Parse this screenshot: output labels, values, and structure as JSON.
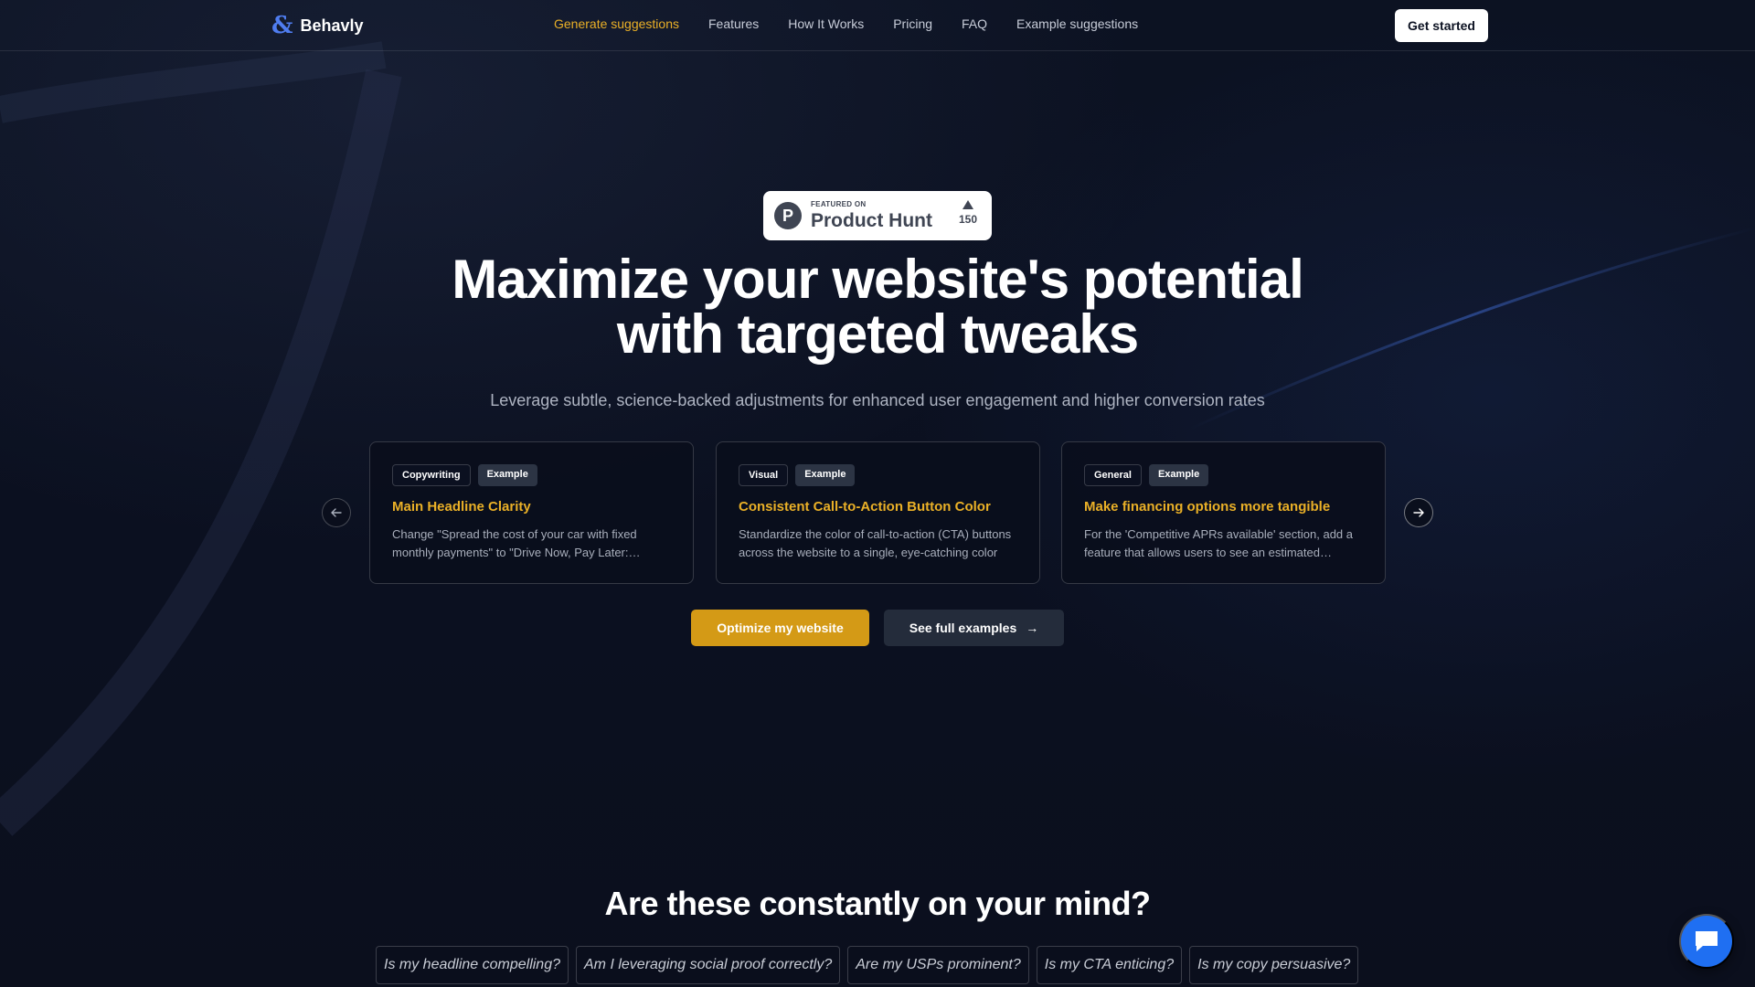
{
  "brand": {
    "name": "Behavly",
    "icon": "ampersand-logo-icon",
    "accent": "#4f7df0"
  },
  "nav": {
    "links": [
      {
        "label": "Generate suggestions",
        "active": true
      },
      {
        "label": "Features"
      },
      {
        "label": "How It Works"
      },
      {
        "label": "Pricing"
      },
      {
        "label": "FAQ"
      },
      {
        "label": "Example suggestions"
      }
    ],
    "cta": "Get started"
  },
  "badge": {
    "featured": "FEATURED ON",
    "name": "Product Hunt",
    "votes": "150",
    "logo_letter": "P"
  },
  "hero": {
    "title_line1": "Maximize your website's potential",
    "title_line2": "with targeted tweaks",
    "subtitle": "Leverage subtle, science-backed adjustments for enhanced user engagement and higher conversion rates"
  },
  "cards": [
    {
      "category": "Copywriting",
      "tag": "Example",
      "title": "Main Headline Clarity",
      "description": "Change \"Spread the cost of your car with fixed monthly payments\" to \"Drive Now, Pay Later: Flexible Monthly Payments\""
    },
    {
      "category": "Visual",
      "tag": "Example",
      "title": "Consistent Call-to-Action Button Color",
      "description": "Standardize the color of call-to-action (CTA) buttons across the website to a single, eye-catching color"
    },
    {
      "category": "General",
      "tag": "Example",
      "title": "Make financing options more tangible",
      "description": "For the 'Competitive APRs available' section, add a feature that allows users to see an estimated monthly payment"
    }
  ],
  "buttons": {
    "optimize": "Optimize my website",
    "examples": "See full examples",
    "examples_arrow": "→"
  },
  "section2": {
    "title": "Are these constantly on your mind?",
    "questions": [
      "Is my headline compelling?",
      "Am I leveraging social proof correctly?",
      "Are my USPs prominent?",
      "Is my CTA enticing?",
      "Is my copy persuasive?"
    ]
  },
  "colors": {
    "background": "#0b1020",
    "accent_gold": "#eab027",
    "button_gold": "#d49a16",
    "chat_blue": "#1f6ff2"
  }
}
